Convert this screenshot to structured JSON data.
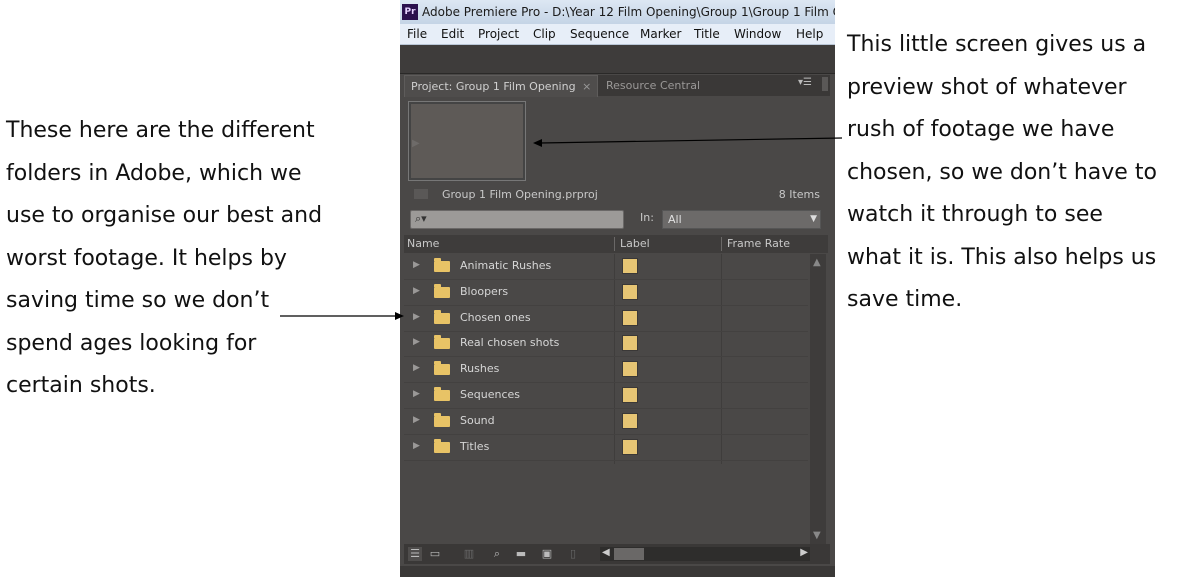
{
  "annotations": {
    "left": [
      "These here are the different",
      "folders in Adobe, which we",
      "use to organise our best and",
      "worst footage. It helps by",
      "saving time so we don’t",
      "spend ages looking for",
      "certain shots."
    ],
    "right": [
      "This little screen gives us a",
      "preview shot of whatever",
      "rush of footage we have",
      "chosen, so we don’t have to",
      "watch it through to see",
      "what it is. This also helps us",
      "save time."
    ]
  },
  "window": {
    "logo": "Pr",
    "title": "Adobe Premiere Pro - D:\\Year 12 Film Opening\\Group 1\\Group 1 Film O"
  },
  "menu": [
    "File",
    "Edit",
    "Project",
    "Clip",
    "Sequence",
    "Marker",
    "Title",
    "Window",
    "Help"
  ],
  "panel": {
    "tab_project": "Project: Group 1 Film Opening",
    "tab_close": "×",
    "tab_resource": "Resource Central",
    "panel_menu": "▾☰",
    "project_file": "Group 1 Film Opening.prproj",
    "item_count": "8 Items",
    "in_label": "In:",
    "in_value": "All"
  },
  "columns": {
    "name": "Name",
    "label": "Label",
    "frame_rate": "Frame Rate"
  },
  "items": [
    {
      "name": "Animatic Rushes"
    },
    {
      "name": "Bloopers"
    },
    {
      "name": "Chosen ones"
    },
    {
      "name": "Real chosen shots"
    },
    {
      "name": "Rushes"
    },
    {
      "name": "Sequences"
    },
    {
      "name": "Sound"
    },
    {
      "name": "Titles"
    }
  ],
  "colors": {
    "folder": "#e8c366",
    "label_swatch": "#e6c574",
    "panel_bg": "#4a4847"
  }
}
